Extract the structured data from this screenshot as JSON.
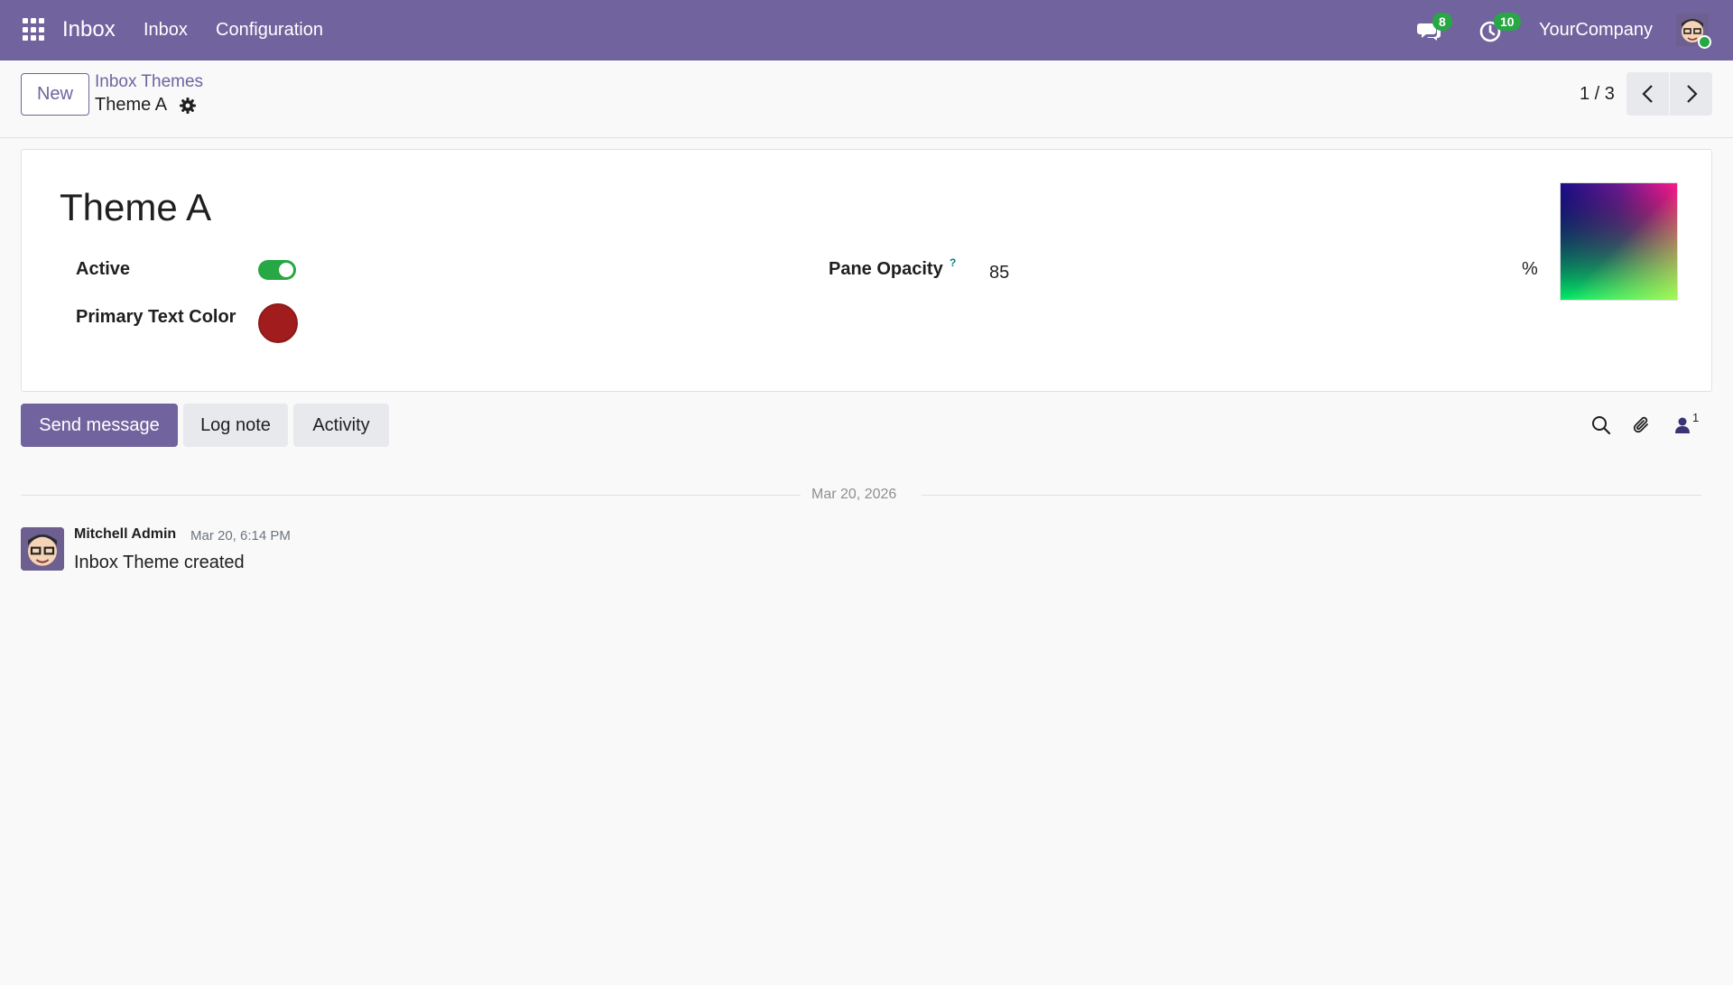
{
  "navbar": {
    "brand": "Inbox",
    "menu": [
      "Inbox",
      "Configuration"
    ],
    "messages_badge": "8",
    "activities_badge": "10",
    "company": "YourCompany",
    "background": "#71639e"
  },
  "control_panel": {
    "new_label": "New",
    "breadcrumb_parent": "Inbox Themes",
    "breadcrumb_current": "Theme A",
    "pager": "1 / 3"
  },
  "form": {
    "title": "Theme A",
    "active_label": "Active",
    "active_value": true,
    "primary_text_color_label": "Primary Text Color",
    "primary_text_color_value": "#a11d1d",
    "pane_opacity_label": "Pane Opacity",
    "pane_opacity_help": "?",
    "pane_opacity_value": "85",
    "pane_opacity_unit": "%"
  },
  "chatter": {
    "send_message_label": "Send message",
    "log_note_label": "Log note",
    "activity_label": "Activity",
    "followers_count": "1",
    "date_separator": "Mar 20, 2026",
    "messages": [
      {
        "author": "Mitchell Admin",
        "date": "Mar 20, 6:14 PM",
        "body": "Inbox Theme created"
      }
    ]
  },
  "colors": {
    "accent": "#71639e",
    "success": "#28a745",
    "link_help": "#017e84"
  }
}
